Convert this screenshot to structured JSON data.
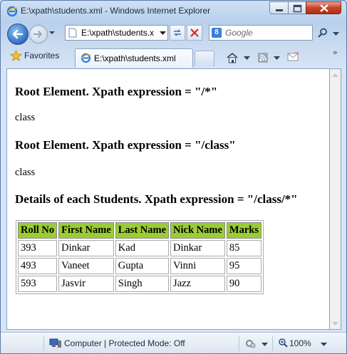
{
  "window": {
    "title": "E:\\xpath\\students.xml - Windows Internet Explorer"
  },
  "address": {
    "url": "E:\\xpath\\students.x"
  },
  "search": {
    "placeholder": "Google",
    "provider_letter": "8"
  },
  "favorites": {
    "label": "Favorites"
  },
  "tab": {
    "label": "E:\\xpath\\students.xml"
  },
  "page": {
    "heading1": "Root Element. Xpath expression = \"/*\"",
    "text1": "class",
    "heading2": "Root Element. Xpath expression = \"/class\"",
    "text2": "class",
    "heading3": "Details of each Students. Xpath expression = \"/class/*\"",
    "table": {
      "headers": [
        "Roll No",
        "First Name",
        "Last Name",
        "Nick Name",
        "Marks"
      ],
      "rows": [
        [
          "393",
          "Dinkar",
          "Kad",
          "Dinkar",
          "85"
        ],
        [
          "493",
          "Vaneet",
          "Gupta",
          "Vinni",
          "95"
        ],
        [
          "593",
          "Jasvir",
          "Singh",
          "Jazz",
          "90"
        ]
      ],
      "header_color": "#9acd32"
    }
  },
  "status": {
    "zone": "Computer | Protected Mode: Off",
    "zoom": "100%"
  },
  "colors": {
    "chrome": "#c9daf0",
    "close_button": "#c5442a"
  }
}
